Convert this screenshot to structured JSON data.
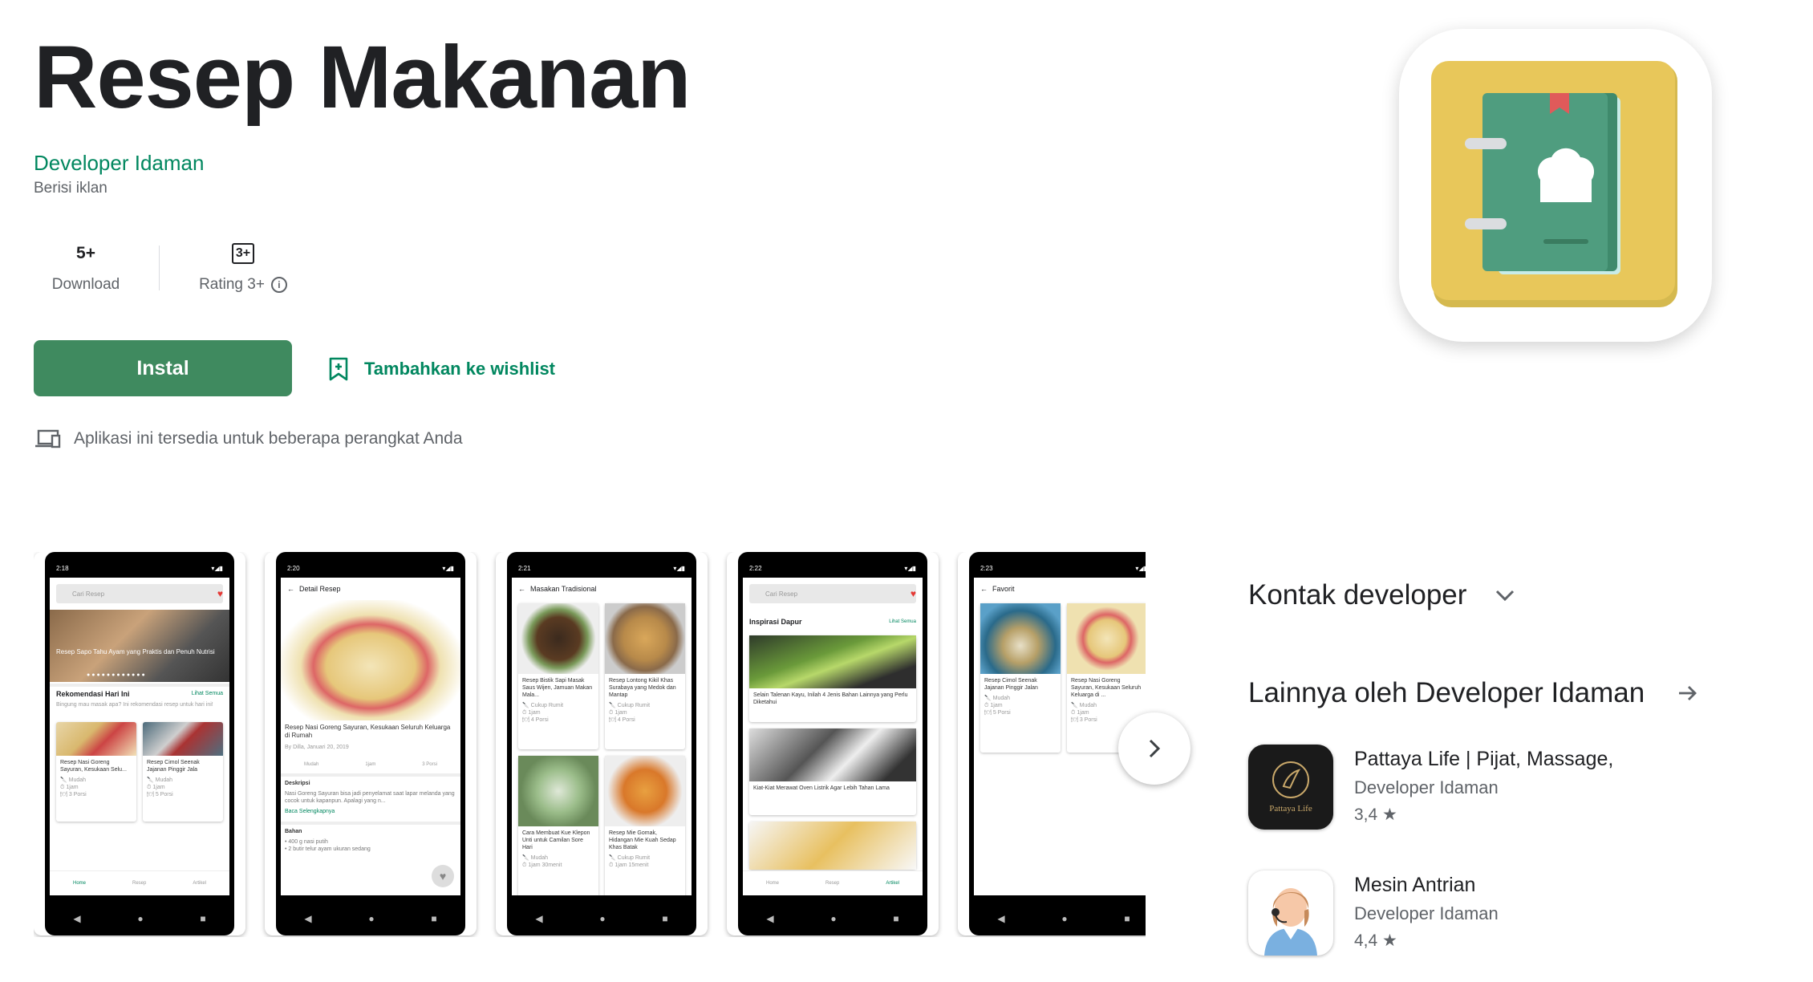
{
  "app": {
    "title": "Resep Makanan",
    "developer": "Developer Idaman",
    "ads_note": "Berisi iklan"
  },
  "stats": {
    "downloads_value": "5+",
    "downloads_label": "Download",
    "rating_badge": "3+",
    "rating_label": "Rating 3+"
  },
  "actions": {
    "install": "Instal",
    "wishlist": "Tambahkan ke wishlist",
    "devices_note": "Aplikasi ini tersedia untuk beberapa perangkat Anda"
  },
  "screenshots": [
    {
      "time": "2:18",
      "search_placeholder": "Cari Resep",
      "banner": "Resep Sapo Tahu Ayam yang Praktis dan Penuh Nutrisi",
      "section": "Rekomendasi Hari Ini",
      "see_all": "Lihat Semua",
      "subtitle": "Bingung mau masak apa? Ini rekomendasi resep untuk hari ini!",
      "card1": "Resep Nasi Goreng Sayuran, Kesukaan Selu...",
      "card2": "Resep Cimol Seenak Jajanan Pinggir Jala",
      "meta1": "Mudah",
      "meta2": "1jam",
      "meta3": "3 Porsi",
      "meta4": "5 Porsi",
      "nav": [
        "Home",
        "Resep",
        "Artikel"
      ]
    },
    {
      "time": "2:20",
      "header": "Detail Resep",
      "recipe_title": "Resep Nasi Goreng Sayuran, Kesukaan Seluruh Keluarga di Rumah",
      "byline": "By Dilla, Januari 20, 2019",
      "icons": [
        "Mudah",
        "1jam",
        "3 Porsi"
      ],
      "desc_title": "Deskripsi",
      "desc": "Nasi Goreng Sayuran bisa jadi penyelamat saat lapar melanda yang cocok untuk kapanpun. Apalagi yang n...",
      "read_more": "Baca Selengkapnya",
      "ingredients_title": "Bahan",
      "ingredients": [
        "400 g nasi putih",
        "2 butir telur ayam ukuran sedang"
      ]
    },
    {
      "time": "2:21",
      "header": "Masakan Tradisional",
      "items": [
        "Resep Bistik Sapi Masak Saus Wijen, Jamuan Makan Mala...",
        "Resep Lontong Kikil Khas Surabaya yang Medok dan Mantap",
        "Cara Membuat Kue Klepon Unti untuk Camilan Sore Hari",
        "Resep Mie Gomak, Hidangan Mie Kuah Sedap Khas Batak"
      ],
      "meta": [
        "Cukup Rumit",
        "1jam",
        "4 Porsi",
        "Mudah",
        "1jam 30menit",
        "Cukup Rumit",
        "1jam 15menit"
      ]
    },
    {
      "time": "2:22",
      "search_placeholder": "Cari Resep",
      "section": "Inspirasi Dapur",
      "see_all": "Lihat Semua",
      "articles": [
        "Selain Talenan Kayu, Inilah 4 Jenis Bahan Lainnya yang Perlu Diketahui",
        "Kiat-Kiat Merawat Oven Listrik Agar Lebih Tahan Lama"
      ],
      "nav": [
        "Home",
        "Resep",
        "Artikel"
      ]
    },
    {
      "time": "2:23",
      "header": "Favorit",
      "items": [
        "Resep Cimol Seenak Jajanan Pinggir Jalan",
        "Resep Nasi Goreng Sayuran, Kesukaan Seluruh Keluarga di ..."
      ],
      "meta": [
        "Mudah",
        "1jam",
        "5 Porsi",
        "Mudah",
        "1jam",
        "3 Porsi"
      ]
    }
  ],
  "sidebar": {
    "contact": "Kontak developer",
    "more_by": "Lainnya oleh Developer Idaman",
    "apps": [
      {
        "name": "Pattaya Life | Pijat, Massage,",
        "developer": "Developer Idaman",
        "rating": "3,4",
        "logo_text": "Pattaya Life"
      },
      {
        "name": "Mesin Antrian",
        "developer": "Developer Idaman",
        "rating": "4,4"
      }
    ]
  },
  "colors": {
    "accent": "#01875f",
    "install_bg": "#3f8a5f",
    "icon_yellow": "#e8c75a",
    "icon_green": "#4f9d7f"
  }
}
